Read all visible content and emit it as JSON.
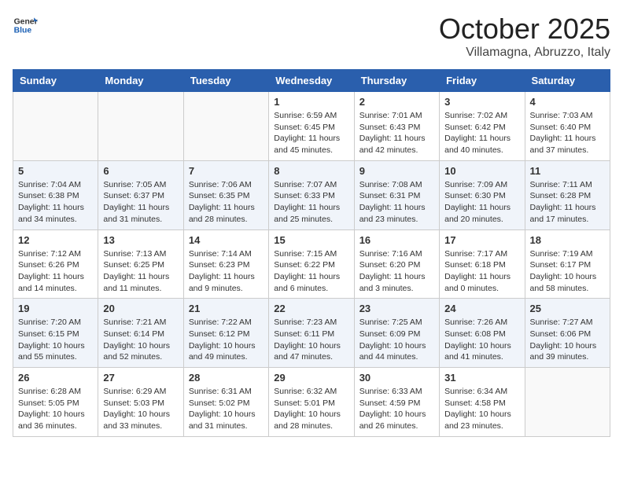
{
  "header": {
    "logo_general": "General",
    "logo_blue": "Blue",
    "month_title": "October 2025",
    "subtitle": "Villamagna, Abruzzo, Italy"
  },
  "days_of_week": [
    "Sunday",
    "Monday",
    "Tuesday",
    "Wednesday",
    "Thursday",
    "Friday",
    "Saturday"
  ],
  "weeks": [
    [
      {
        "day": "",
        "info": ""
      },
      {
        "day": "",
        "info": ""
      },
      {
        "day": "",
        "info": ""
      },
      {
        "day": "1",
        "info": "Sunrise: 6:59 AM\nSunset: 6:45 PM\nDaylight: 11 hours\nand 45 minutes."
      },
      {
        "day": "2",
        "info": "Sunrise: 7:01 AM\nSunset: 6:43 PM\nDaylight: 11 hours\nand 42 minutes."
      },
      {
        "day": "3",
        "info": "Sunrise: 7:02 AM\nSunset: 6:42 PM\nDaylight: 11 hours\nand 40 minutes."
      },
      {
        "day": "4",
        "info": "Sunrise: 7:03 AM\nSunset: 6:40 PM\nDaylight: 11 hours\nand 37 minutes."
      }
    ],
    [
      {
        "day": "5",
        "info": "Sunrise: 7:04 AM\nSunset: 6:38 PM\nDaylight: 11 hours\nand 34 minutes."
      },
      {
        "day": "6",
        "info": "Sunrise: 7:05 AM\nSunset: 6:37 PM\nDaylight: 11 hours\nand 31 minutes."
      },
      {
        "day": "7",
        "info": "Sunrise: 7:06 AM\nSunset: 6:35 PM\nDaylight: 11 hours\nand 28 minutes."
      },
      {
        "day": "8",
        "info": "Sunrise: 7:07 AM\nSunset: 6:33 PM\nDaylight: 11 hours\nand 25 minutes."
      },
      {
        "day": "9",
        "info": "Sunrise: 7:08 AM\nSunset: 6:31 PM\nDaylight: 11 hours\nand 23 minutes."
      },
      {
        "day": "10",
        "info": "Sunrise: 7:09 AM\nSunset: 6:30 PM\nDaylight: 11 hours\nand 20 minutes."
      },
      {
        "day": "11",
        "info": "Sunrise: 7:11 AM\nSunset: 6:28 PM\nDaylight: 11 hours\nand 17 minutes."
      }
    ],
    [
      {
        "day": "12",
        "info": "Sunrise: 7:12 AM\nSunset: 6:26 PM\nDaylight: 11 hours\nand 14 minutes."
      },
      {
        "day": "13",
        "info": "Sunrise: 7:13 AM\nSunset: 6:25 PM\nDaylight: 11 hours\nand 11 minutes."
      },
      {
        "day": "14",
        "info": "Sunrise: 7:14 AM\nSunset: 6:23 PM\nDaylight: 11 hours\nand 9 minutes."
      },
      {
        "day": "15",
        "info": "Sunrise: 7:15 AM\nSunset: 6:22 PM\nDaylight: 11 hours\nand 6 minutes."
      },
      {
        "day": "16",
        "info": "Sunrise: 7:16 AM\nSunset: 6:20 PM\nDaylight: 11 hours\nand 3 minutes."
      },
      {
        "day": "17",
        "info": "Sunrise: 7:17 AM\nSunset: 6:18 PM\nDaylight: 11 hours\nand 0 minutes."
      },
      {
        "day": "18",
        "info": "Sunrise: 7:19 AM\nSunset: 6:17 PM\nDaylight: 10 hours\nand 58 minutes."
      }
    ],
    [
      {
        "day": "19",
        "info": "Sunrise: 7:20 AM\nSunset: 6:15 PM\nDaylight: 10 hours\nand 55 minutes."
      },
      {
        "day": "20",
        "info": "Sunrise: 7:21 AM\nSunset: 6:14 PM\nDaylight: 10 hours\nand 52 minutes."
      },
      {
        "day": "21",
        "info": "Sunrise: 7:22 AM\nSunset: 6:12 PM\nDaylight: 10 hours\nand 49 minutes."
      },
      {
        "day": "22",
        "info": "Sunrise: 7:23 AM\nSunset: 6:11 PM\nDaylight: 10 hours\nand 47 minutes."
      },
      {
        "day": "23",
        "info": "Sunrise: 7:25 AM\nSunset: 6:09 PM\nDaylight: 10 hours\nand 44 minutes."
      },
      {
        "day": "24",
        "info": "Sunrise: 7:26 AM\nSunset: 6:08 PM\nDaylight: 10 hours\nand 41 minutes."
      },
      {
        "day": "25",
        "info": "Sunrise: 7:27 AM\nSunset: 6:06 PM\nDaylight: 10 hours\nand 39 minutes."
      }
    ],
    [
      {
        "day": "26",
        "info": "Sunrise: 6:28 AM\nSunset: 5:05 PM\nDaylight: 10 hours\nand 36 minutes."
      },
      {
        "day": "27",
        "info": "Sunrise: 6:29 AM\nSunset: 5:03 PM\nDaylight: 10 hours\nand 33 minutes."
      },
      {
        "day": "28",
        "info": "Sunrise: 6:31 AM\nSunset: 5:02 PM\nDaylight: 10 hours\nand 31 minutes."
      },
      {
        "day": "29",
        "info": "Sunrise: 6:32 AM\nSunset: 5:01 PM\nDaylight: 10 hours\nand 28 minutes."
      },
      {
        "day": "30",
        "info": "Sunrise: 6:33 AM\nSunset: 4:59 PM\nDaylight: 10 hours\nand 26 minutes."
      },
      {
        "day": "31",
        "info": "Sunrise: 6:34 AM\nSunset: 4:58 PM\nDaylight: 10 hours\nand 23 minutes."
      },
      {
        "day": "",
        "info": ""
      }
    ]
  ]
}
